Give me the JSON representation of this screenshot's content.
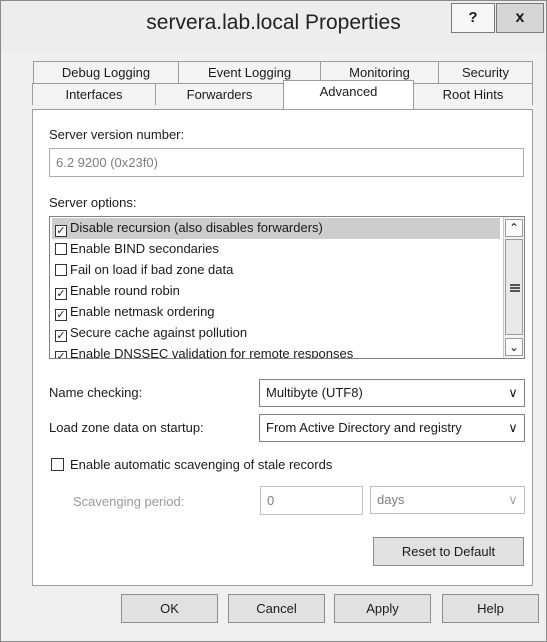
{
  "window": {
    "title": "servera.lab.local Properties",
    "help_glyph": "?",
    "close_glyph": "x"
  },
  "tabs": {
    "row1": [
      "Debug Logging",
      "Event Logging",
      "Monitoring",
      "Security"
    ],
    "row2": [
      "Interfaces",
      "Forwarders",
      "Advanced",
      "Root Hints"
    ],
    "active": "Advanced"
  },
  "advanced": {
    "server_version_label": "Server version number:",
    "server_version_value": "6.2 9200 (0x23f0)",
    "server_options_label": "Server options:",
    "server_options": [
      {
        "label": "Disable recursion (also disables forwarders)",
        "checked": true,
        "selected": true
      },
      {
        "label": "Enable BIND secondaries",
        "checked": false,
        "selected": false
      },
      {
        "label": "Fail on load if bad zone data",
        "checked": false,
        "selected": false
      },
      {
        "label": "Enable round robin",
        "checked": true,
        "selected": false
      },
      {
        "label": "Enable netmask ordering",
        "checked": true,
        "selected": false
      },
      {
        "label": "Secure cache against pollution",
        "checked": true,
        "selected": false
      },
      {
        "label": "Enable DNSSEC validation for remote responses",
        "checked": true,
        "selected": false
      }
    ],
    "name_checking_label": "Name checking:",
    "name_checking_value": "Multibyte (UTF8)",
    "load_zone_label": "Load zone data on startup:",
    "load_zone_value": "From Active Directory and registry",
    "scavenging_checkbox_label": "Enable automatic scavenging of stale records",
    "scavenging_checked": false,
    "scavenging_period_label": "Scavenging period:",
    "scavenging_period_value": "0",
    "scavenging_unit_value": "days",
    "reset_label": "Reset to Default"
  },
  "footer": {
    "ok_label": "OK",
    "cancel_label": "Cancel",
    "apply_label": "Apply",
    "help_label": "Help"
  },
  "icons": {
    "scroll_up": "chevron-up-icon",
    "scroll_down": "chevron-down-icon",
    "dropdown": "chevron-down-icon",
    "checkmark": "checkmark-icon"
  }
}
